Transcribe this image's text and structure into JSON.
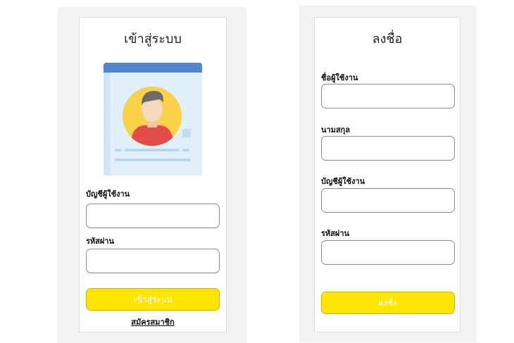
{
  "login": {
    "title": "เข้าสู่ระบบ",
    "username_label": "บัญชีผู้ใช้งาน",
    "password_label": "รหัสผ่าน",
    "submit_label": "เข้าสู่ระบบ",
    "register_link": "สมัครสมาชิก",
    "illustration_icon": "user-profile-card-icon"
  },
  "register": {
    "title": "ลงชื่อ",
    "firstname_label": "ชื่อผู้ใช้งาน",
    "lastname_label": "นามสกุล",
    "username_label": "บัญชีผู้ใช้งาน",
    "password_label": "รหัสผ่าน",
    "submit_label": "ลงชื่อ"
  },
  "colors": {
    "button": "#ffe600",
    "panel_background": "#f2f2f2",
    "card_border": "#dcdcdc",
    "field_border": "#8a8a8a"
  }
}
